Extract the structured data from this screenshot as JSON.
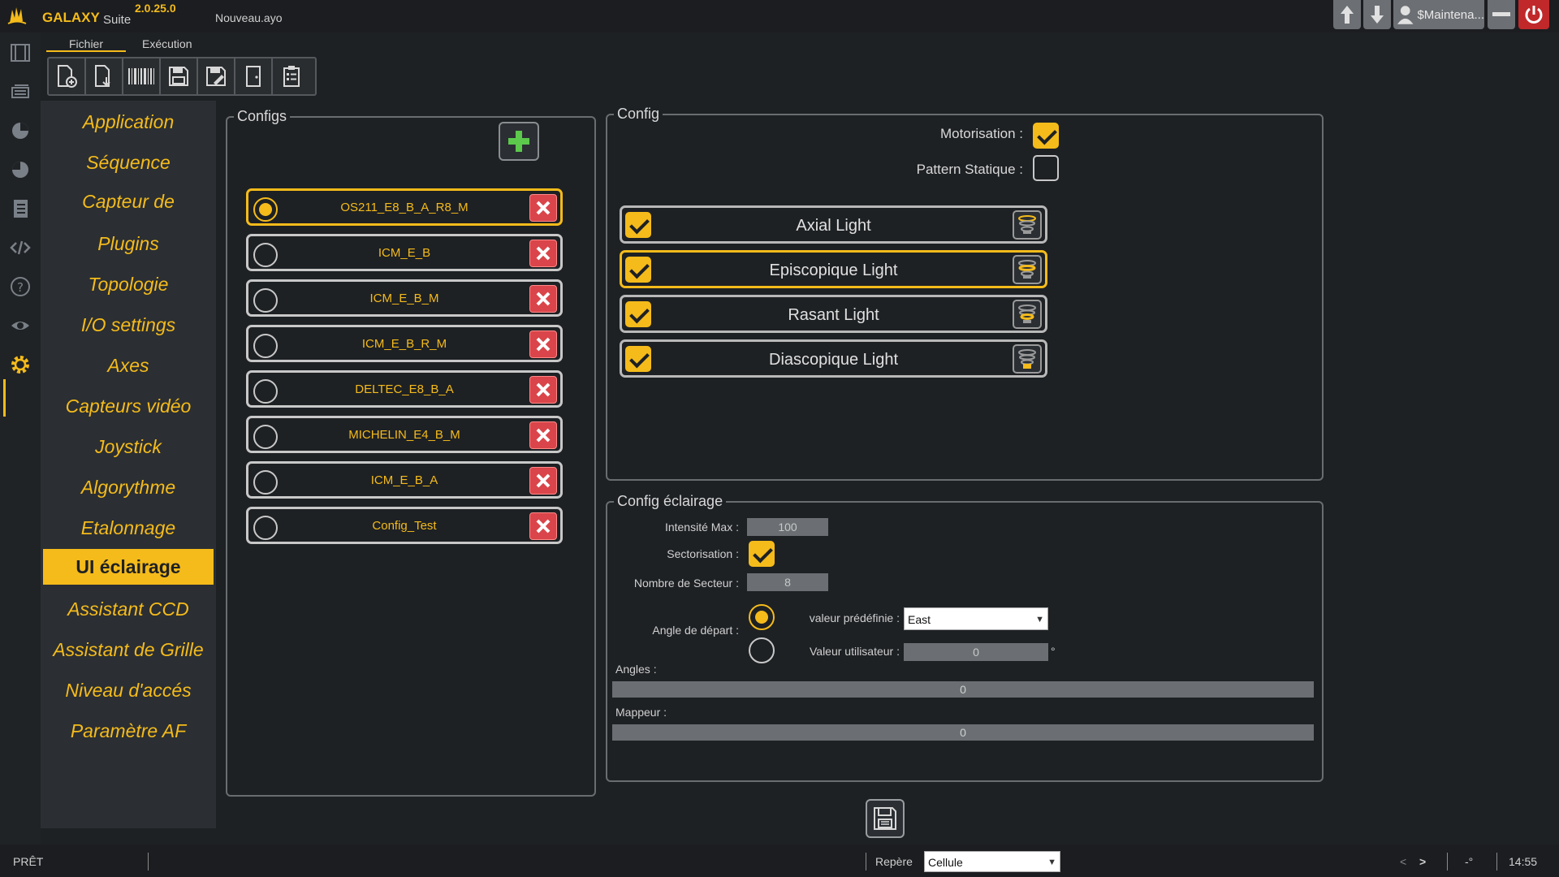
{
  "app": {
    "brand": "GALAXY",
    "suite": "Suite",
    "version": "2.0.25.0",
    "document": "Nouveau.ayo",
    "user": "$Maintena..."
  },
  "ribbon": {
    "tabs": [
      "Fichier",
      "Exécution"
    ],
    "active_tab": "Fichier",
    "buttons": [
      "new-file-icon",
      "open-file-icon",
      "barcode-icon",
      "save-icon",
      "save-as-icon",
      "door-exit-icon",
      "checklist-icon"
    ]
  },
  "nav": {
    "items": [
      "Application",
      "Séquence",
      "Capteur de",
      "Plugins",
      "Topologie",
      "I/O settings",
      "Axes",
      "Capteurs vidéo",
      "Joystick",
      "Algorythme",
      "Etalonnage",
      "UI éclairage",
      "Assistant CCD",
      "Assistant de Grille",
      "Niveau d'accés",
      "Paramètre AF"
    ],
    "active": "UI éclairage"
  },
  "configs": {
    "title": "Configs",
    "items": [
      {
        "name": "OS211_E8_B_A_R8_M",
        "selected": true
      },
      {
        "name": "ICM_E_B",
        "selected": false
      },
      {
        "name": "ICM_E_B_M",
        "selected": false
      },
      {
        "name": "ICM_E_B_R_M",
        "selected": false
      },
      {
        "name": "DELTEC_E8_B_A",
        "selected": false
      },
      {
        "name": "MICHELIN_E4_B_M",
        "selected": false
      },
      {
        "name": "ICM_E_B_A",
        "selected": false
      },
      {
        "name": "Config_Test",
        "selected": false
      }
    ]
  },
  "config": {
    "title": "Config",
    "motorisation_label": "Motorisation :",
    "motorisation": true,
    "pattern_label": "Pattern Statique :",
    "pattern": false,
    "lights": [
      {
        "name": "Axial Light",
        "checked": true,
        "selected": false
      },
      {
        "name": "Episcopique Light",
        "checked": true,
        "selected": true
      },
      {
        "name": "Rasant Light",
        "checked": true,
        "selected": false
      },
      {
        "name": "Diascopique Light",
        "checked": true,
        "selected": false
      }
    ]
  },
  "eclairage": {
    "title": "Config éclairage",
    "intensite_label": "Intensité Max :",
    "intensite": "100",
    "sectorisation_label": "Sectorisation :",
    "sectorisation": true,
    "nb_secteur_label": "Nombre de Secteur :",
    "nb_secteur": "8",
    "angle_label": "Angle de départ :",
    "predef_label": "valeur prédéfinie :",
    "predef_value": "East",
    "predef_selected": true,
    "user_label": "Valeur utilisateur :",
    "user_value": "0",
    "degree_symbol": "°",
    "angles_label": "Angles :",
    "angles_value": "0",
    "mappeur_label": "Mappeur :",
    "mappeur_value": "0"
  },
  "status": {
    "ready": "PRÊT",
    "repere_label": "Repère",
    "repere_value": "Cellule",
    "nav_prev": "<",
    "nav_next": ">",
    "degree": "-°",
    "time": "14:55"
  },
  "colors": {
    "accent": "#f5bb1b",
    "delete": "#d9454a",
    "panel": "#2b2f33",
    "background": "#1e2124"
  }
}
